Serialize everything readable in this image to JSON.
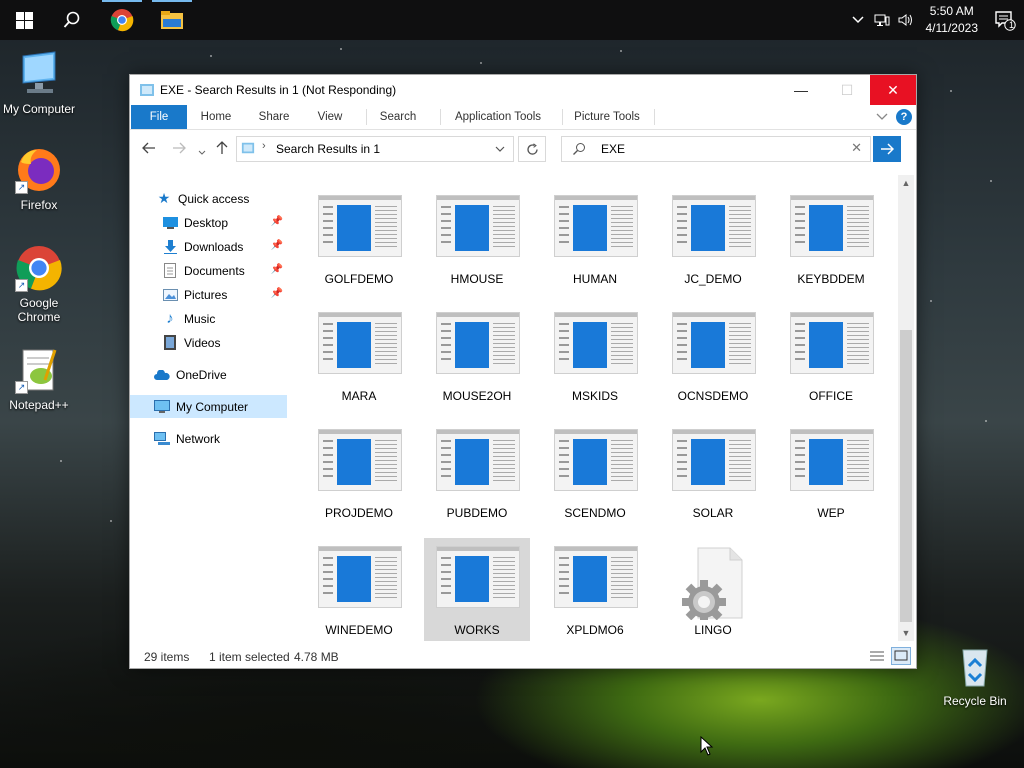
{
  "taskbar": {
    "items": [
      {
        "name": "start",
        "icon": "windows-logo-icon"
      },
      {
        "name": "search",
        "icon": "search-icon"
      },
      {
        "name": "chrome",
        "icon": "chrome-icon"
      },
      {
        "name": "explorer",
        "icon": "folder-icon"
      }
    ],
    "clock": {
      "time": "5:50 AM",
      "date": "4/11/2023"
    },
    "notification_count": "1"
  },
  "desktop_icons": [
    {
      "label": "My Computer",
      "icon": "computer-icon"
    },
    {
      "label": "Firefox",
      "icon": "firefox-icon"
    },
    {
      "label": "Google Chrome",
      "icon": "chrome-icon"
    },
    {
      "label": "Notepad++",
      "icon": "notepadpp-icon"
    },
    {
      "label": "Recycle Bin",
      "icon": "recycle-bin-icon"
    }
  ],
  "window": {
    "title": "EXE - Search Results in 1 (Not Responding)",
    "controls": {
      "minimize": "—",
      "maximize": "☐",
      "close": "✕"
    },
    "ribbon_tabs": [
      "File",
      "Home",
      "Share",
      "View",
      "Search",
      "Application Tools",
      "Picture Tools"
    ],
    "address": {
      "path": "Search Results in 1"
    },
    "search": {
      "value": "EXE"
    },
    "nav": {
      "quick_access": "Quick access",
      "pinned": [
        {
          "label": "Desktop",
          "icon": "desktop-icon"
        },
        {
          "label": "Downloads",
          "icon": "downloads-icon"
        },
        {
          "label": "Documents",
          "icon": "documents-icon"
        },
        {
          "label": "Pictures",
          "icon": "pictures-icon"
        }
      ],
      "libraries": [
        {
          "label": "Music",
          "icon": "music-icon"
        },
        {
          "label": "Videos",
          "icon": "videos-icon"
        }
      ],
      "onedrive": "OneDrive",
      "my_computer": "My Computer",
      "network": "Network"
    },
    "files": [
      "GOLFDEMO",
      "HMOUSE",
      "HUMAN",
      "JC_DEMO",
      "KEYBDDEM",
      "MARA",
      "MOUSE2OH",
      "MSKIDS",
      "OCNSDEMO",
      "OFFICE",
      "PROJDEMO",
      "PUBDEMO",
      "SCENDMO",
      "SOLAR",
      "WEP",
      "WINEDEMO",
      "WORKS",
      "XPLDMO6",
      "LINGO"
    ],
    "selected_file": "WORKS",
    "status": {
      "count": "29 items",
      "selection": "1 item selected",
      "size": "4.78 MB"
    }
  },
  "colors": {
    "accent": "#1979ca",
    "close_red": "#e81123",
    "selection": "#cce8ff"
  }
}
